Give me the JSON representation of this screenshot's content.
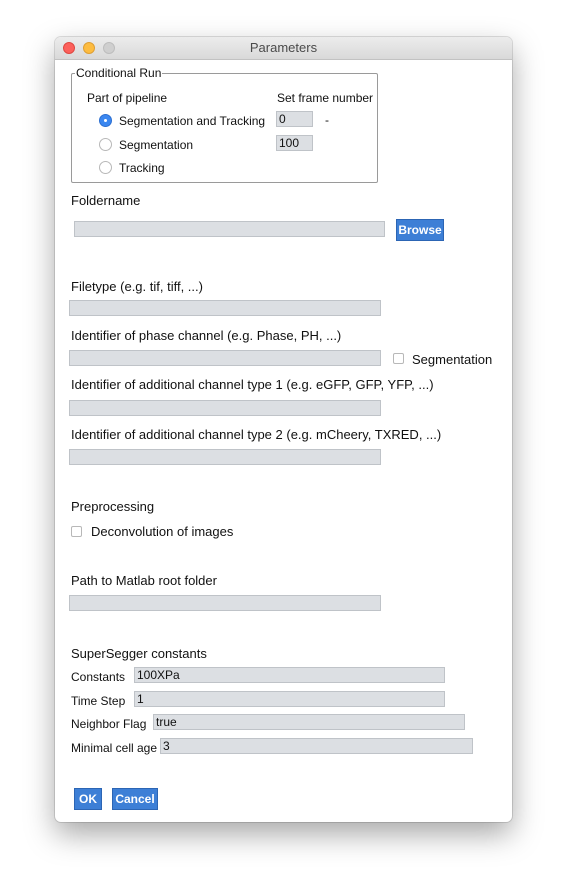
{
  "window": {
    "title": "Parameters"
  },
  "conditional_run": {
    "group_title": "Conditional Run",
    "part_of_pipeline_label": "Part of pipeline",
    "set_frame_number_label": "Set frame number",
    "options": [
      {
        "label": "Segmentation and Tracking",
        "selected": true
      },
      {
        "label": "Segmentation",
        "selected": false
      },
      {
        "label": "Tracking",
        "selected": false
      }
    ],
    "frame_start": "0",
    "frame_separator": "-",
    "frame_end": "100"
  },
  "foldername": {
    "label": "Foldername",
    "value": "",
    "browse_label": "Browse"
  },
  "filetype": {
    "label": "Filetype (e.g. tif, tiff, ...)",
    "value": ""
  },
  "phase_channel": {
    "label": "Identifier of phase channel (e.g. Phase, PH, ...)",
    "value": "",
    "segmentation_label": "Segmentation",
    "segmentation_checked": false
  },
  "additional_channel_1": {
    "label": "Identifier of additional channel type 1 (e.g. eGFP, GFP, YFP, ...)",
    "value": ""
  },
  "additional_channel_2": {
    "label": "Identifier of additional channel type 2 (e.g. mCheery, TXRED, ...)",
    "value": ""
  },
  "preprocessing": {
    "label": "Preprocessing",
    "deconvolution_label": "Deconvolution of images",
    "deconvolution_checked": false
  },
  "matlab": {
    "label": "Path to Matlab root folder",
    "value": ""
  },
  "supersegger": {
    "label": "SuperSegger constants",
    "constants_label": "Constants",
    "constants_value": "100XPa",
    "time_step_label": "Time Step",
    "time_step_value": "1",
    "neighbor_flag_label": "Neighbor Flag",
    "neighbor_flag_value": "true",
    "min_cell_age_label": "Minimal cell age",
    "min_cell_age_value": "3"
  },
  "buttons": {
    "ok_label": "OK",
    "cancel_label": "Cancel"
  },
  "colors": {
    "button": "#3d7fd6",
    "field": "#dcdfe3",
    "radio_selected": "#3b87f0"
  }
}
